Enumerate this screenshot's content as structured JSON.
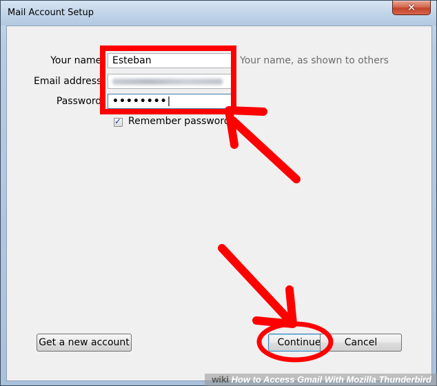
{
  "window": {
    "title": "Mail Account Setup",
    "close_glyph": "✕"
  },
  "form": {
    "name_label": "Your name:",
    "name_value": "Esteban",
    "name_hint": "Your name, as shown to others",
    "email_label": "Email address:",
    "email_value_state": "blurred",
    "password_label": "Password:",
    "password_value": "••••••••",
    "remember_label": "Remember password",
    "remember_checked": true,
    "check_glyph": "✓"
  },
  "buttons": {
    "get_account": "Get a new account",
    "continue": "Continue",
    "cancel": "Cancel"
  },
  "annotations": {
    "highlight_color": "#ff0000"
  },
  "watermark": {
    "brand": "wiki",
    "text": "How to Access Gmail With Mozilla Thunderbird"
  }
}
